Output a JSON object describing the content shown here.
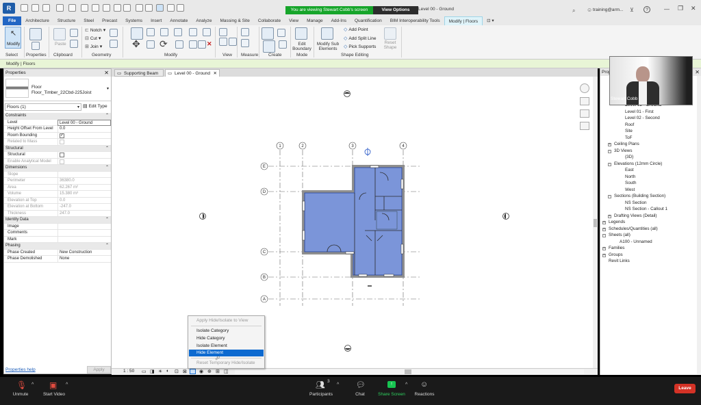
{
  "titlebar": {
    "share_banner": "You are viewing Stewart Cobb's screen",
    "view_options": "View Options",
    "doc_title": "Level 00 - Ground",
    "user": "training@arm..."
  },
  "ribbon_tabs": [
    "File",
    "Architecture",
    "Structure",
    "Steel",
    "Precast",
    "Systems",
    "Insert",
    "Annotate",
    "Analyze",
    "Massing & Site",
    "Collaborate",
    "View",
    "Manage",
    "Add-Ins",
    "Quantification",
    "BIM Interoperability Tools",
    "Modify | Floors"
  ],
  "ribbon": {
    "modify_label": "Modify",
    "paste_label": "Paste",
    "notch_label": "Notch",
    "cut_label": "Cut",
    "join_label": "Join",
    "edit_boundary_label": "Edit Boundary",
    "modify_sub_elements_label": "Modify Sub Elements",
    "add_point_label": "Add Point",
    "add_split_line_label": "Add Split Line",
    "pick_supports_label": "Pick Supports",
    "reset_shape_label": "Reset Shape",
    "panels": {
      "select": "Select",
      "properties": "Properties",
      "clipboard": "Clipboard",
      "geometry": "Geometry",
      "modify": "Modify",
      "view": "View",
      "measure": "Measure",
      "create": "Create",
      "mode": "Mode",
      "shape_editing": "Shape Editing"
    }
  },
  "context_bar": "Modify | Floors",
  "properties": {
    "title": "Properties",
    "type_family": "Floor",
    "type_name": "Floor_Timber_22Cbd-225Joist",
    "selector": "Floors (1)",
    "edit_type": "Edit Type",
    "help": "Properties help",
    "apply": "Apply",
    "rows": [
      {
        "k": "Constraints",
        "v": "",
        "kind": "sec"
      },
      {
        "k": "Level",
        "v": "Level 00 - Ground",
        "kind": "field"
      },
      {
        "k": "Height Offset From Level",
        "v": "0.0",
        "kind": ""
      },
      {
        "k": "Room Bounding",
        "v": "",
        "kind": "check"
      },
      {
        "k": "Related to Mass",
        "v": "",
        "kind": "dimcheck"
      },
      {
        "k": "Structural",
        "v": "",
        "kind": "sec"
      },
      {
        "k": "Structural",
        "v": "",
        "kind": "check0"
      },
      {
        "k": "Enable Analytical Model",
        "v": "",
        "kind": "dimcheck"
      },
      {
        "k": "Dimensions",
        "v": "",
        "kind": "sec"
      },
      {
        "k": "Slope",
        "v": "",
        "kind": "dim"
      },
      {
        "k": "Perimeter",
        "v": "36380.0",
        "kind": "dim"
      },
      {
        "k": "Area",
        "v": "62.267 m²",
        "kind": "dim"
      },
      {
        "k": "Volume",
        "v": "15.380 m³",
        "kind": "dim"
      },
      {
        "k": "Elevation at Top",
        "v": "0.0",
        "kind": "dim"
      },
      {
        "k": "Elevation at Bottom",
        "v": "-247.0",
        "kind": "dim"
      },
      {
        "k": "Thickness",
        "v": "247.0",
        "kind": "dim"
      },
      {
        "k": "Identity Data",
        "v": "",
        "kind": "sec"
      },
      {
        "k": "Image",
        "v": "",
        "kind": ""
      },
      {
        "k": "Comments",
        "v": "",
        "kind": ""
      },
      {
        "k": "Mark",
        "v": "",
        "kind": ""
      },
      {
        "k": "Phasing",
        "v": "",
        "kind": "sec"
      },
      {
        "k": "Phase Created",
        "v": "New Construction",
        "kind": ""
      },
      {
        "k": "Phase Demolished",
        "v": "None",
        "kind": ""
      }
    ]
  },
  "view_tabs": [
    "Supporting Beam",
    "Level 00 - Ground"
  ],
  "view_scale": "1 : 50",
  "grids": {
    "columns": [
      "1",
      "2",
      "3",
      "4"
    ],
    "rows": [
      "E",
      "D",
      "C",
      "B",
      "A"
    ]
  },
  "context_menu": {
    "items": [
      {
        "label": "Apply Hide/Isolate to View",
        "state": "disabled"
      },
      {
        "label": "Isolate Category",
        "state": "normal"
      },
      {
        "label": "Hide Category",
        "state": "normal"
      },
      {
        "label": "Isolate Element",
        "state": "normal"
      },
      {
        "label": "Hide Element",
        "state": "selected"
      },
      {
        "label": "Reset Temporary Hide/Isolate",
        "state": "disabled"
      }
    ]
  },
  "browser": {
    "title": "Project Browser",
    "nodes": [
      {
        "label": "Level 00 - Ground",
        "indent": 3,
        "box": "",
        "bold": true
      },
      {
        "label": "Level 01 - First",
        "indent": 3,
        "box": ""
      },
      {
        "label": "Level 02 - Second",
        "indent": 3,
        "box": ""
      },
      {
        "label": "Roof",
        "indent": 3,
        "box": ""
      },
      {
        "label": "Site",
        "indent": 3,
        "box": ""
      },
      {
        "label": "ToF",
        "indent": 3,
        "box": ""
      },
      {
        "label": "Ceiling Plans",
        "indent": 1,
        "box": "+"
      },
      {
        "label": "3D Views",
        "indent": 1,
        "box": "-"
      },
      {
        "label": "{3D}",
        "indent": 3,
        "box": ""
      },
      {
        "label": "Elevations (12mm Circle)",
        "indent": 1,
        "box": "-"
      },
      {
        "label": "East",
        "indent": 3,
        "box": ""
      },
      {
        "label": "North",
        "indent": 3,
        "box": ""
      },
      {
        "label": "South",
        "indent": 3,
        "box": ""
      },
      {
        "label": "West",
        "indent": 3,
        "box": ""
      },
      {
        "label": "Sections (Building Section)",
        "indent": 1,
        "box": "-"
      },
      {
        "label": "NS Section",
        "indent": 3,
        "box": ""
      },
      {
        "label": "NS Section - Callout 1",
        "indent": 3,
        "box": ""
      },
      {
        "label": "Drafting Views (Detail)",
        "indent": 1,
        "box": "+"
      },
      {
        "label": "Legends",
        "indent": 0,
        "box": "+"
      },
      {
        "label": "Schedules/Quantities (all)",
        "indent": 0,
        "box": "+"
      },
      {
        "label": "Sheets (all)",
        "indent": 0,
        "box": "-"
      },
      {
        "label": "A100 - Unnamed",
        "indent": 2,
        "box": ""
      },
      {
        "label": "Families",
        "indent": 0,
        "box": "+"
      },
      {
        "label": "Groups",
        "indent": 0,
        "box": "+"
      },
      {
        "label": "Revit Links",
        "indent": 0,
        "box": ""
      }
    ]
  },
  "webcam": {
    "name": "Stewart Cobb"
  },
  "zoom_bar": {
    "unmute": "Unmute",
    "start_video": "Start Video",
    "participants": "Participants",
    "participants_count": "3",
    "chat": "Chat",
    "share_screen": "Share Screen",
    "reactions": "Reactions",
    "leave": "Leave"
  },
  "colors": {
    "floor_fill": "#7b95d9",
    "selection_blue": "#0d6ad0",
    "share_green": "#16a52a",
    "file_tab": "#2266c4",
    "leave_red": "#d43226"
  }
}
